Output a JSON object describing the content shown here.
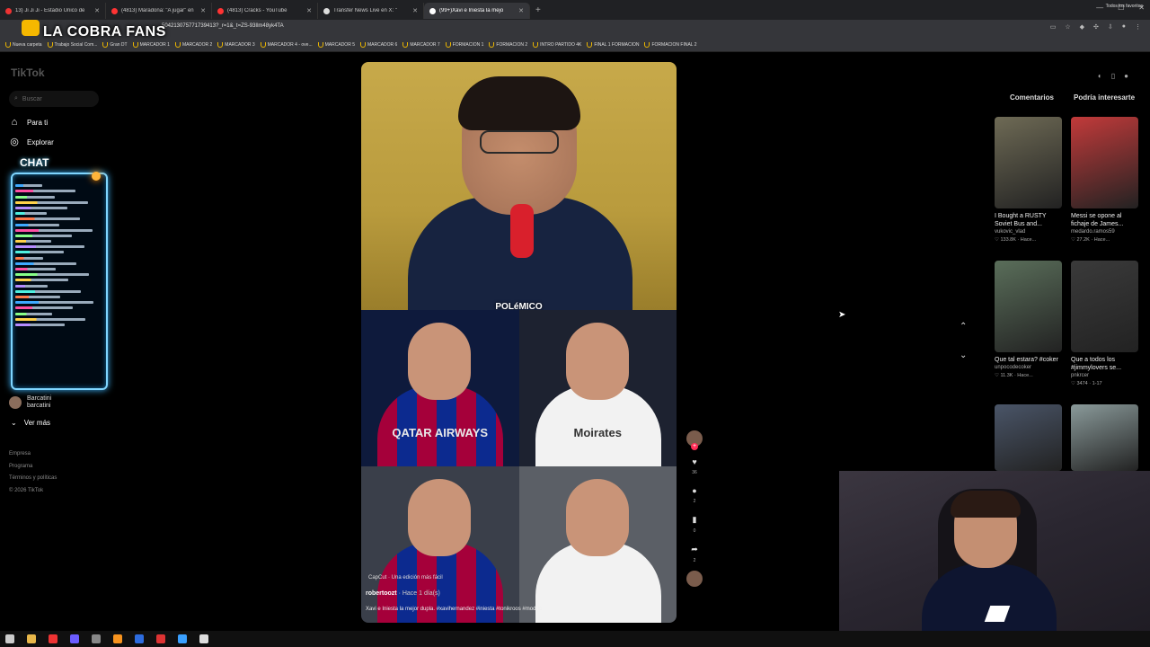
{
  "browser": {
    "tabs": [
      {
        "label": "13) Ji Ji Ji - Estadio Único de",
        "color": "#e33"
      },
      {
        "label": "(4813) Maradona: \"A jugar\" en",
        "color": "#f33"
      },
      {
        "label": "(4813) Cracks - YouTube",
        "color": "#f33"
      },
      {
        "label": "Transfer News Live en X: \"",
        "color": "#ddd"
      },
      {
        "label": "(99+)Xavi e Iniesta la mejo",
        "color": "#fff"
      }
    ],
    "new_tab": "+",
    "url": "504213075771739413?_r=1&_t=ZS-93Ilm48yk4TA",
    "bookmarks": [
      "Nueva carpeta",
      "Trabajo Social Com...",
      "Gran DT",
      "MARCADOR 1",
      "MARCADOR 2",
      "MARCADOR 3",
      "MARCADOR 4 - ove...",
      "MARCADOR 5",
      "MARCADOR 6",
      "MARCADOR 7",
      "FORMACION 1",
      "FORMACION 2",
      "INTRO PARTIDO 4K",
      "FINAL 1 FORMACION",
      "FORMACION FINAL 2"
    ],
    "all_bookmarks": "Todos los favoritos"
  },
  "overlay": {
    "title": "LA COBRA FANS",
    "chat_label": "CHAT"
  },
  "sidebar": {
    "logo": "TikTok",
    "search_placeholder": "Buscar",
    "nav": [
      {
        "label": "Para ti",
        "icon": "home-icon"
      },
      {
        "label": "Explorar",
        "icon": "compass-icon"
      }
    ],
    "following": {
      "name": "Barcatini",
      "handle": "barcatini"
    },
    "more": "Ver más",
    "footer": [
      "Empresa",
      "Programa",
      "Términos y políticas",
      "© 2026 TikTok"
    ]
  },
  "video": {
    "overlay_text": "POLéMICO",
    "kit_texts": [
      "QATAR AIRWAYS",
      "Moirates",
      "",
      ""
    ],
    "capcut": "CapCut · Una edición más fácil",
    "username": "robertoozt",
    "time": "· Hace 1 día(s)",
    "description": "Xavi e Iniesta la mejor dupla. #xavihernandez #iniesta #tonikroos #modric"
  },
  "actions": {
    "likes": "36",
    "comments": "2",
    "saves": "0",
    "shares": "2"
  },
  "right_panel": {
    "tabs": [
      "Comentarios",
      "Podría interesarte"
    ],
    "items": [
      {
        "title": "I Bought a RUSTY Soviet Bus and...",
        "author": "vukovic_vlad",
        "stats": "♡ 133.8K · Hace...",
        "color": "#6e6a55"
      },
      {
        "title": "Messi se opone al fichaje de James...",
        "author": "medardo.ramos59",
        "stats": "♡ 27.2K · Hace...",
        "color": "#c23a3a"
      },
      {
        "title": "Que tal estara? #coker",
        "author": "unpocodecoker",
        "stats": "♡ 11.3K · Hace...",
        "color": "#5a6e5a"
      },
      {
        "title": "Que a todos los #jimmylovers se...",
        "author": "pnkrcer",
        "stats": "♡ 3474 · 1-17",
        "color": "#3a3a3a"
      },
      {
        "title": "",
        "author": "",
        "stats": "",
        "color": "#4a5568"
      },
      {
        "title": "",
        "author": "",
        "stats": "",
        "color": "#8a9a9a"
      }
    ]
  },
  "taskbar": {
    "icons": [
      {
        "name": "windows-icon",
        "color": "#ccc"
      },
      {
        "name": "folder-icon",
        "color": "#e8b74a"
      },
      {
        "name": "chrome-icon",
        "color": "#e33"
      },
      {
        "name": "app-icon",
        "color": "#6b5cff"
      },
      {
        "name": "obs-icon",
        "color": "#888"
      },
      {
        "name": "media-icon",
        "color": "#f7931e"
      },
      {
        "name": "browser-icon",
        "color": "#2d6cdf"
      },
      {
        "name": "chrome-icon",
        "color": "#d33"
      },
      {
        "name": "app-icon",
        "color": "#3aa0ff"
      },
      {
        "name": "window-icon",
        "color": "#ddd"
      }
    ]
  }
}
